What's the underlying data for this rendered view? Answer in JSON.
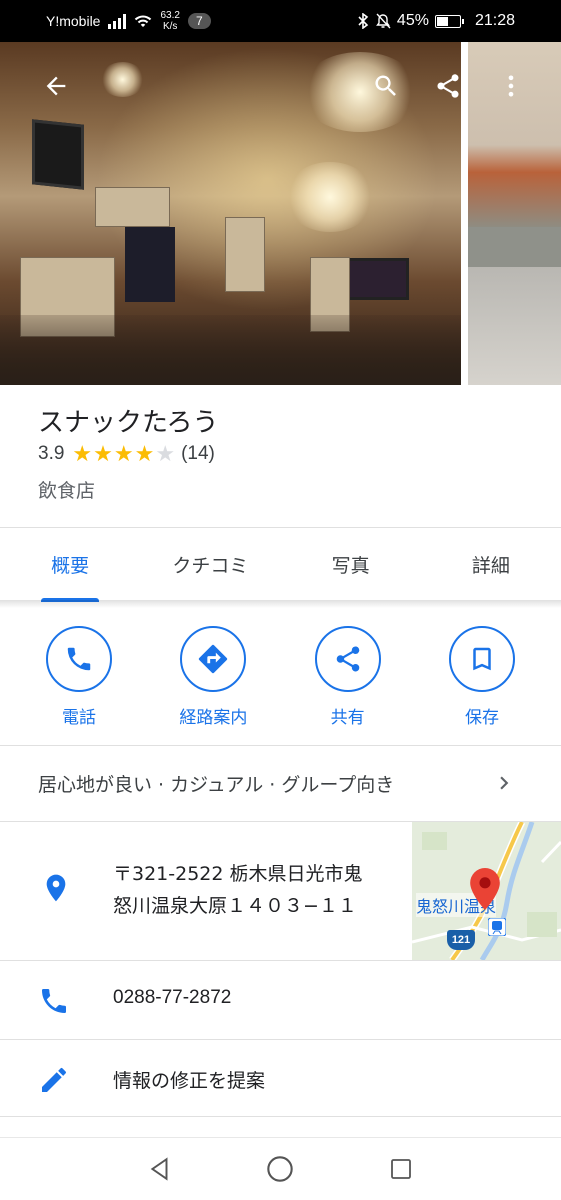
{
  "status_bar": {
    "carrier": "Y!mobile",
    "net_speed_value": "63.2",
    "net_speed_unit": "K/s",
    "notification_count": "7",
    "battery_percent": "45%",
    "battery_level": 0.45,
    "time": "21:28"
  },
  "hero": {
    "back_icon": "arrow-left-icon",
    "search_icon": "search-icon",
    "share_icon": "share-icon",
    "more_icon": "more-vert-icon"
  },
  "place": {
    "name": "スナックたろう",
    "rating": "3.9",
    "rating_value": 3.9,
    "stars_max": 5,
    "review_count": "(14)",
    "category": "飲食店"
  },
  "tabs": [
    {
      "label": "概要",
      "active": true
    },
    {
      "label": "クチコミ",
      "active": false
    },
    {
      "label": "写真",
      "active": false
    },
    {
      "label": "詳細",
      "active": false
    }
  ],
  "actions": [
    {
      "label": "電話",
      "icon": "phone-icon"
    },
    {
      "label": "経路案内",
      "icon": "directions-icon"
    },
    {
      "label": "共有",
      "icon": "share-icon"
    },
    {
      "label": "保存",
      "icon": "bookmark-icon"
    }
  ],
  "attributes": "居心地が良い · カジュアル · グループ向き",
  "address": {
    "line1": "〒321-2522 栃木県日光市鬼",
    "line2": "怒川温泉大原１４０３−１１",
    "map_label": "鬼怒川温泉",
    "route_number": "121"
  },
  "phone": "0288-77-2872",
  "suggest_edit": "情報の修正を提案",
  "colors": {
    "accent": "#1a73e8",
    "star": "#fbbc04",
    "map_pin": "#ea4335"
  }
}
